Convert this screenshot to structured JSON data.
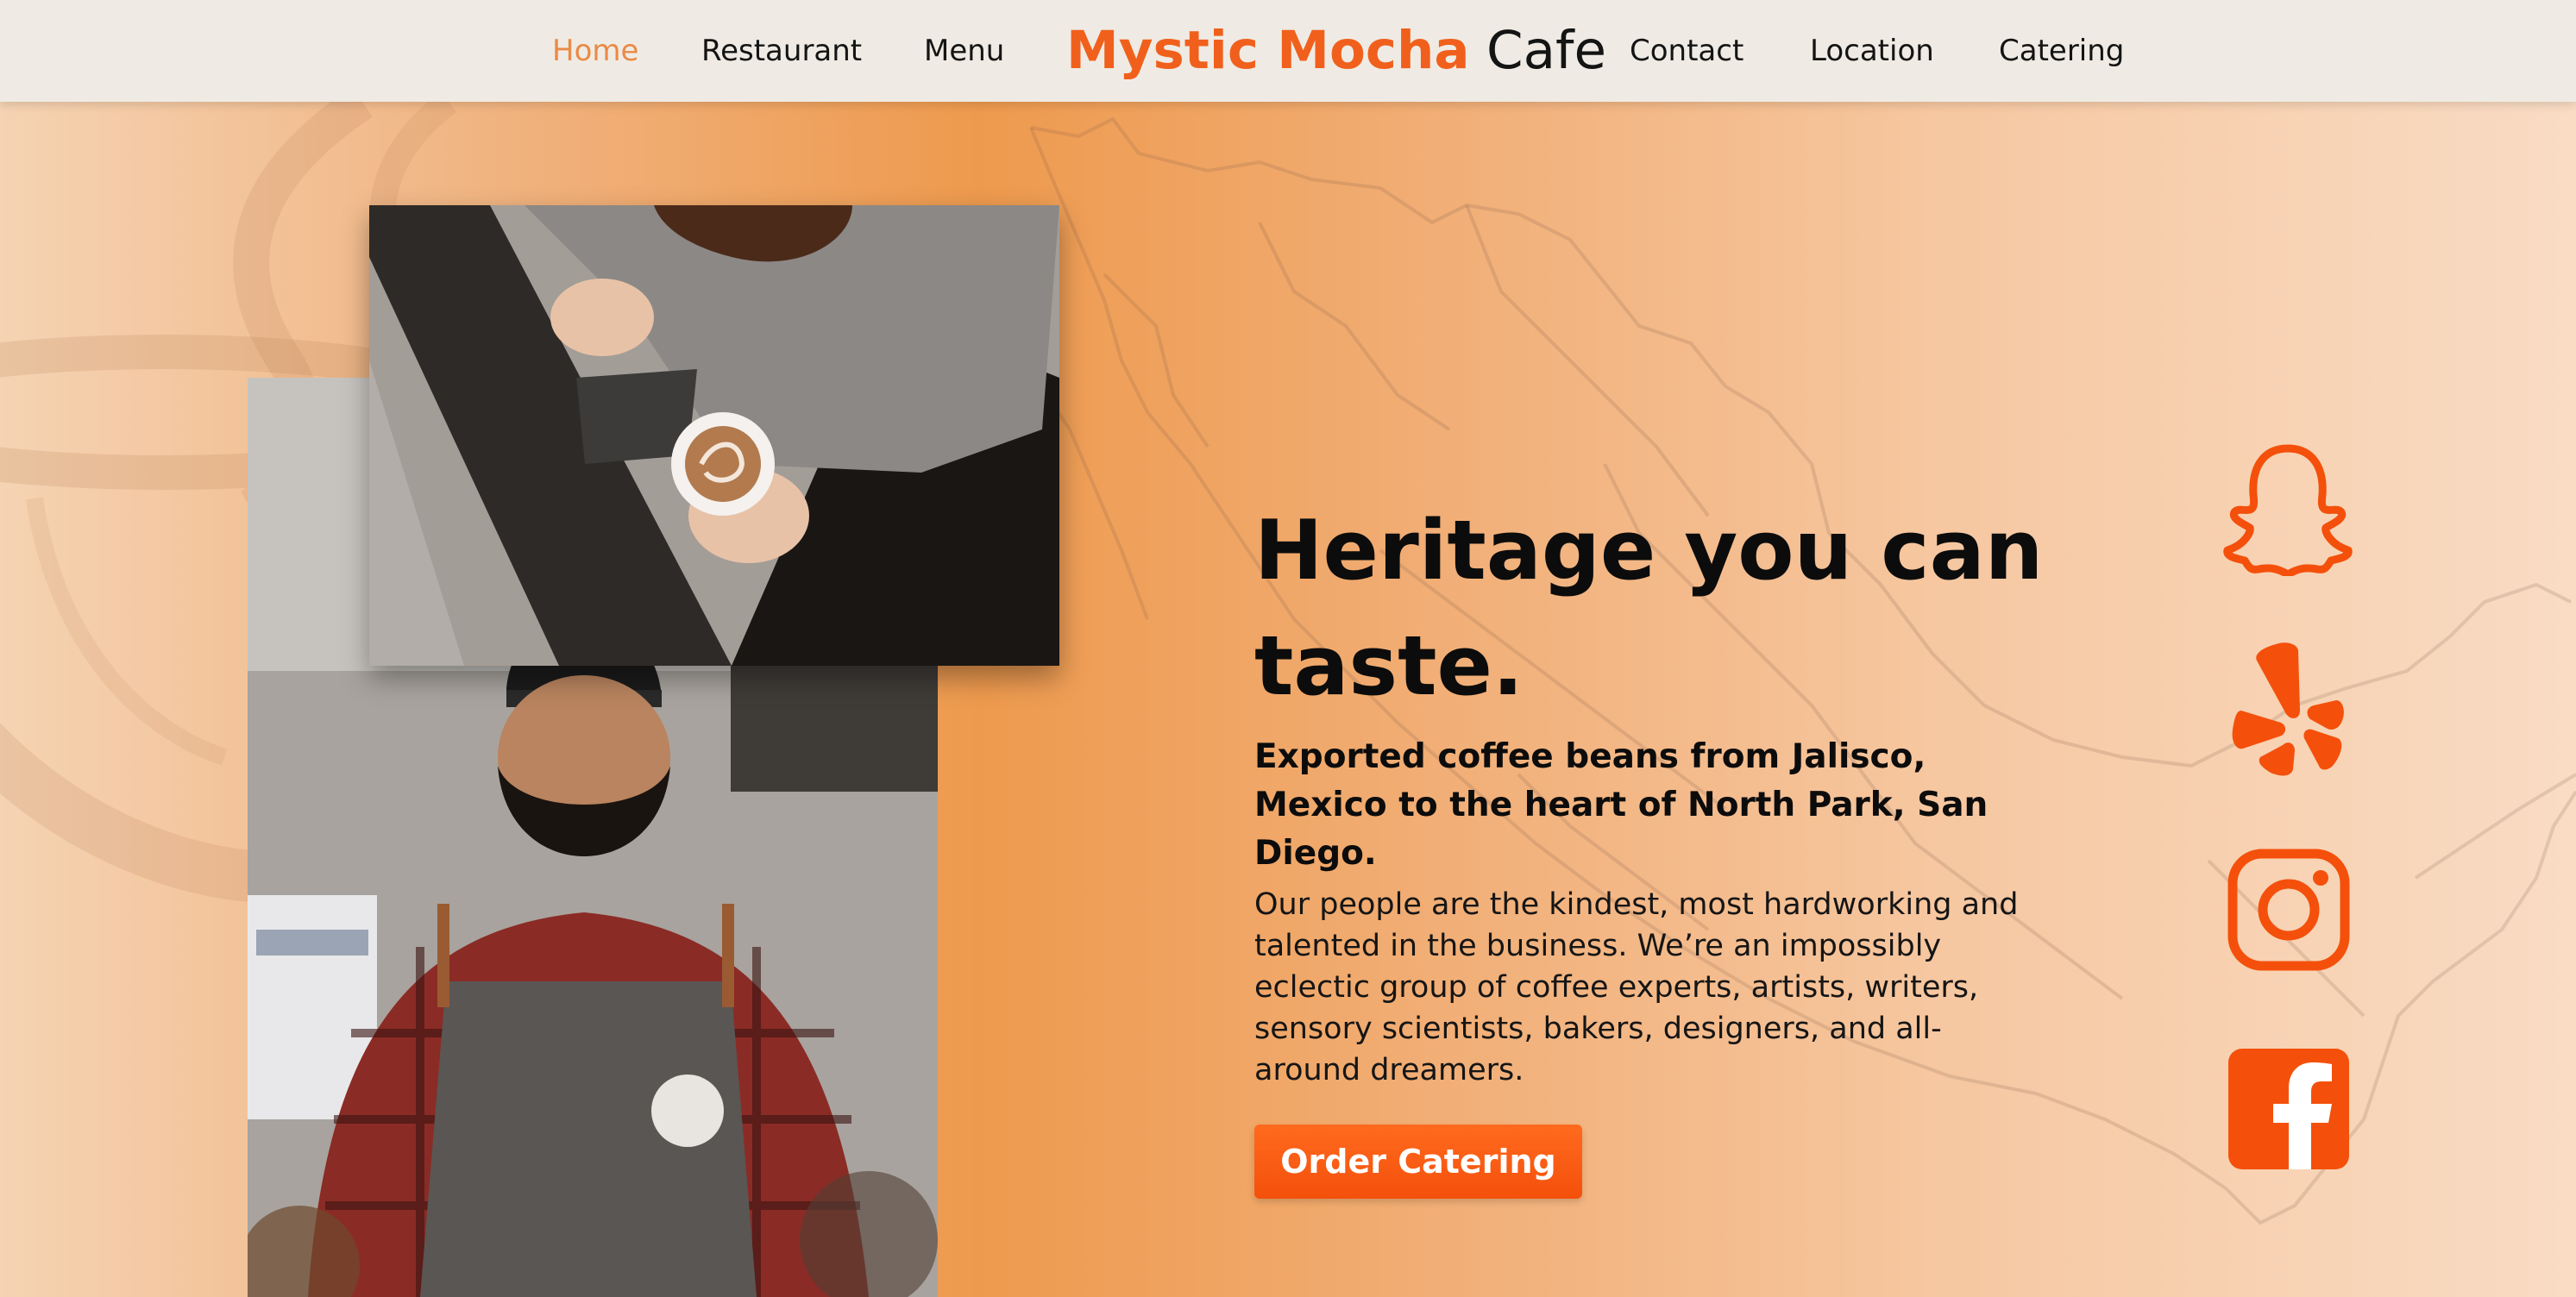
{
  "nav": {
    "items": [
      {
        "label": "Home",
        "active": true
      },
      {
        "label": "Restaurant"
      },
      {
        "label": "Menu"
      },
      {
        "label": "Contact"
      },
      {
        "label": "Location"
      },
      {
        "label": "Catering"
      }
    ],
    "brand_primary": "Mystic Mocha",
    "brand_secondary": "Cafe"
  },
  "hero": {
    "title": "Heritage you can taste.",
    "subtitle": "Exported coffee beans from Jalisco, Mexico to the heart of North Park, San Diego.",
    "body": "Our people are the kindest, most hardworking and talented in the business. We’re an impossibly eclectic group of coffee experts, artists, writers, sensory scientists, bakers, designers, and all-around dreamers.",
    "cta": "Order Catering"
  },
  "social": [
    "snapchat-icon",
    "yelp-icon",
    "instagram-icon",
    "facebook-icon"
  ],
  "colors": {
    "accent": "#f4500b",
    "nav_active": "#ea8a45",
    "nav_bg": "#efebe4"
  }
}
